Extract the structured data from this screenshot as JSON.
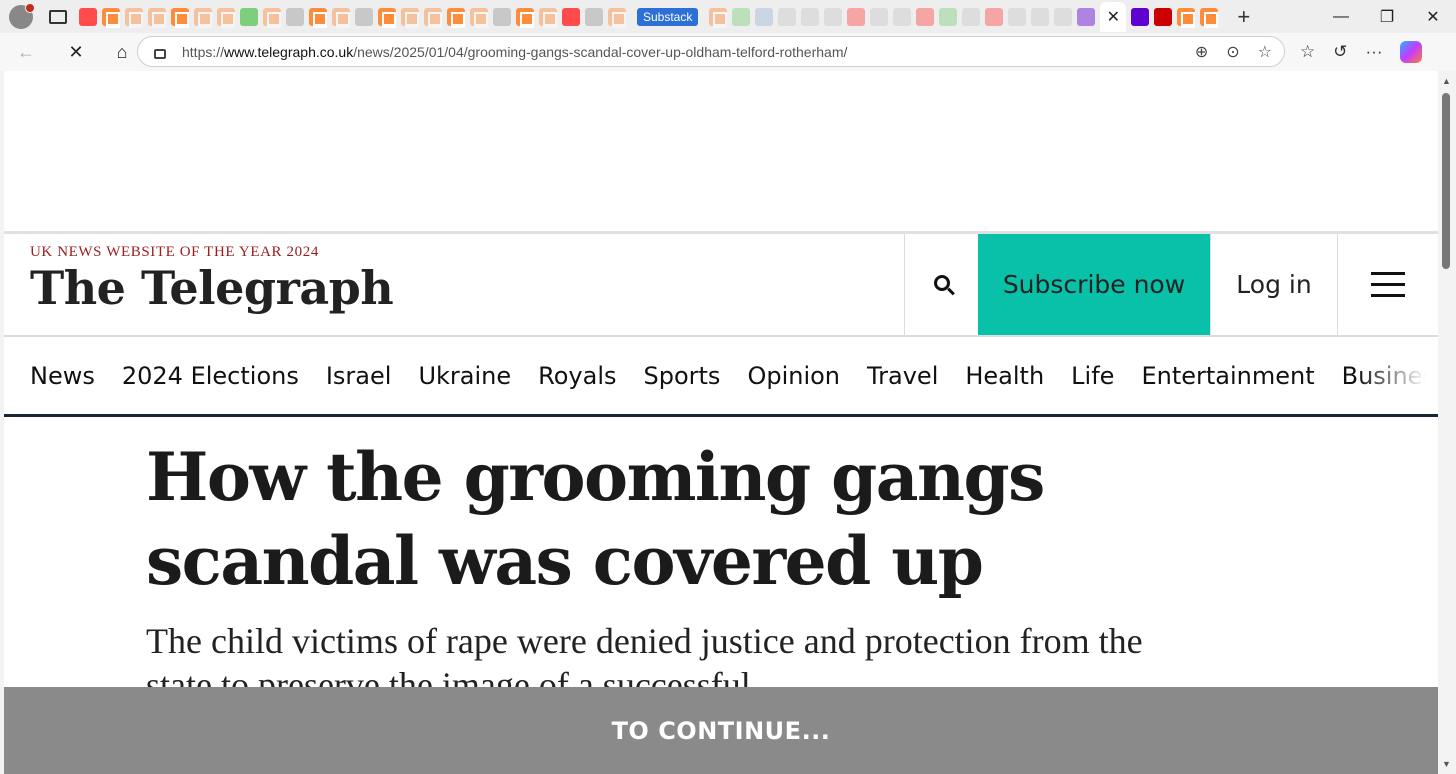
{
  "browser": {
    "tabs": [
      {
        "icon": "youtube-icon"
      },
      {
        "icon": "substack-icon"
      },
      {
        "icon": "substack-icon"
      },
      {
        "icon": "substack-icon"
      },
      {
        "icon": "substack-icon"
      },
      {
        "icon": "substack-icon"
      },
      {
        "icon": "substack-icon"
      },
      {
        "icon": "play-icon"
      },
      {
        "icon": "substack-icon"
      },
      {
        "icon": "page-icon"
      },
      {
        "icon": "substack-icon"
      },
      {
        "icon": "substack-icon"
      },
      {
        "icon": "lock-icon"
      },
      {
        "icon": "substack-icon"
      },
      {
        "icon": "substack-icon"
      },
      {
        "icon": "substack-icon"
      },
      {
        "icon": "substack-icon"
      },
      {
        "icon": "substack-icon"
      },
      {
        "icon": "page-icon"
      },
      {
        "icon": "substack-icon"
      },
      {
        "icon": "substack-icon"
      },
      {
        "icon": "youtube-icon"
      },
      {
        "icon": "gp-icon"
      },
      {
        "icon": "substack-icon"
      }
    ],
    "highlighted_tab_label": "Substack",
    "tabs_after": [
      {
        "icon": "substack-icon"
      },
      {
        "icon": "play-icon"
      },
      {
        "icon": "search-icon"
      },
      {
        "icon": "page-icon"
      },
      {
        "icon": "avatar-icon"
      },
      {
        "icon": "page-icon"
      },
      {
        "icon": "youtube-icon"
      },
      {
        "icon": "page-icon"
      },
      {
        "icon": "page-icon"
      },
      {
        "icon": "youtube-icon"
      },
      {
        "icon": "play-icon"
      },
      {
        "icon": "gp-icon"
      },
      {
        "icon": "youtube-icon"
      },
      {
        "icon": "page-icon"
      },
      {
        "icon": "speaker-icon"
      },
      {
        "icon": "page-icon"
      },
      {
        "icon": "yahoo-icon"
      }
    ],
    "active_tab_close": "✕",
    "tabs_end": [
      {
        "icon": "yahoo-icon"
      },
      {
        "icon": "cnn-icon"
      },
      {
        "icon": "substack-icon"
      },
      {
        "icon": "substack-icon"
      }
    ],
    "new_tab": "+",
    "window_controls": {
      "minimize": "—",
      "restore": "❐",
      "close": "✕"
    },
    "nav": {
      "back": "←",
      "stop": "✕",
      "home": "⌂"
    },
    "url_prefix": "https://",
    "url_domain": "www.telegraph.co.uk",
    "url_path": "/news/2025/01/04/grooming-gangs-scandal-cover-up-oldham-telford-rotherham/",
    "url_actions": {
      "zoom": "⊕",
      "reader": "⊙",
      "favorite": "☆"
    },
    "toolbar": {
      "favorites": "☆",
      "history": "↺",
      "more": "···",
      "notification_count": "1"
    }
  },
  "site": {
    "award": "UK NEWS WEBSITE OF THE YEAR 2024",
    "logo": "The Telegraph",
    "subscribe_label": "Subscribe now",
    "login_label": "Log in",
    "nav_items": [
      "News",
      "2024 Elections",
      "Israel",
      "Ukraine",
      "Royals",
      "Sports",
      "Opinion",
      "Travel",
      "Health",
      "Life",
      "Entertainment",
      "Business"
    ]
  },
  "article": {
    "headline": "How the grooming gangs scandal was covered up",
    "standfirst": "The child victims of rape were denied justice and protection from the state to preserve the image of a successful"
  },
  "overlay": {
    "label": "TO CONTINUE..."
  },
  "colors": {
    "accent_subscribe": "#08c1a8",
    "award_red": "#9b1b1e",
    "nav_underline": "#1b2433",
    "overlay_gray": "#8a8a8a"
  }
}
